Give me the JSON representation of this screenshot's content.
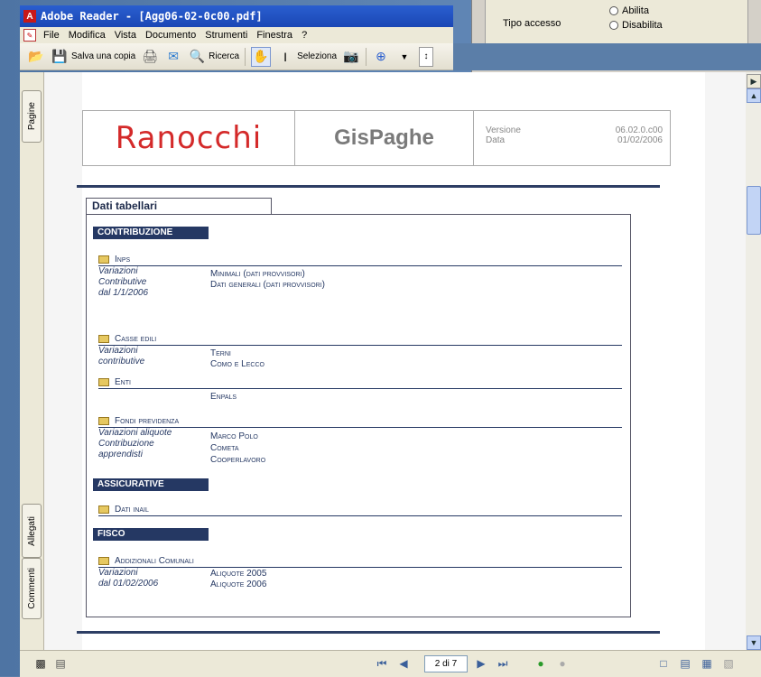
{
  "window": {
    "title": "Adobe Reader - [Agg06-02-0c00.pdf]"
  },
  "background_dialog": {
    "field_label": "Tipo accesso",
    "option_1": "Abilita",
    "option_2": "Disabilita"
  },
  "menu": [
    "File",
    "Modifica",
    "Vista",
    "Documento",
    "Strumenti",
    "Finestra",
    "?"
  ],
  "toolbar": {
    "save_copy": "Salva una copia",
    "search": "Ricerca",
    "select": "Seleziona"
  },
  "side_tabs": {
    "pages": "Pagine",
    "attachments": "Allegati",
    "comments": "Commenti"
  },
  "status": {
    "page_indicator": "2 di 7"
  },
  "doc": {
    "brand": "Ranocchi",
    "product": "GisPaghe",
    "meta_labels": "Versione\nData",
    "meta_values": "06.02.0.c00\n01/02/2006",
    "frame_title": "Dati tabellari",
    "sections": {
      "contribuzione": "CONTRIBUZIONE",
      "assicurative": "ASSICURATIVE",
      "fisco": "FISCO"
    },
    "groups": {
      "inps": "Inps",
      "casse_edili": "Casse edili",
      "enti": "Enti",
      "fondi": "Fondi previdenza",
      "inail": "Dati inail",
      "addizionali": "Addizionali Comunali"
    },
    "notes": {
      "inps": "Variazioni\nContributive\ndal 1/1/2006",
      "casse": "Variazioni\ncontributive",
      "fondi": "Variazioni aliquote\nContribuzione\napprendisti",
      "addizionali": "Variazioni\ndal 01/02/2006"
    },
    "items": {
      "inps_1": "Minimali (dati provvisori)",
      "inps_2": "Dati generali (dati provvisori)",
      "casse_1": "Terni",
      "casse_2": "Como e Lecco",
      "enti_1": "Enpals",
      "fondi_1": "Marco Polo",
      "fondi_2": "Cometa",
      "fondi_3": "Cooperlavoro",
      "add_1": "Aliquote 2005",
      "add_2": "Aliquote 2006"
    }
  }
}
